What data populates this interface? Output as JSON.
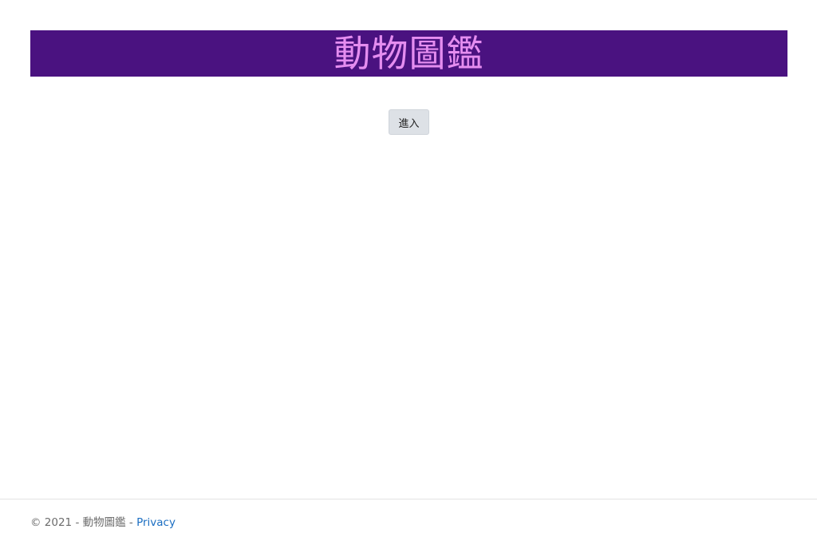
{
  "header": {
    "title": "動物圖鑑"
  },
  "main": {
    "enter_label": "進入"
  },
  "footer": {
    "copyright": "© 2021 - 動物圖鑑 - ",
    "privacy_label": "Privacy"
  },
  "colors": {
    "banner_bg": "#4a1280",
    "banner_text": "#e58df0",
    "link": "#1b6ec2"
  }
}
